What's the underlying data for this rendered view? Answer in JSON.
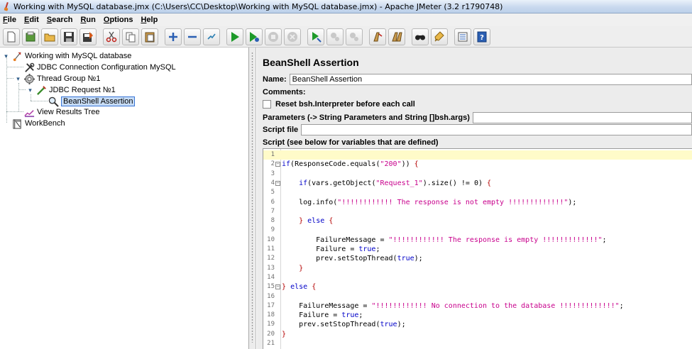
{
  "window": {
    "title": "Working with MySQL database.jmx (C:\\Users\\CC\\Desktop\\Working with MySQL database.jmx) - Apache JMeter (3.2 r1790748)"
  },
  "menu": [
    "File",
    "Edit",
    "Search",
    "Run",
    "Options",
    "Help"
  ],
  "toolbar": [
    "new-icon",
    "templates-icon",
    "open-icon",
    "save-icon",
    "save-as-icon",
    "cut-icon",
    "copy-icon",
    "paste-icon",
    "expand-icon",
    "collapse-icon",
    "toggle-icon",
    "start-icon",
    "start-no-pauses-icon",
    "stop-icon",
    "shutdown-icon",
    "remote-start-icon",
    "remote-stop-icon",
    "remote-shutdown-icon",
    "clear-icon",
    "clear-all-icon",
    "search-icon",
    "reset-search-icon",
    "function-helper-icon",
    "help-icon"
  ],
  "tree": {
    "nodes": [
      {
        "label": "Working with MySQL database",
        "icon": "test-plan-icon"
      },
      {
        "label": "JDBC Connection Configuration MySQL",
        "icon": "config-element-icon"
      },
      {
        "label": "Thread Group №1",
        "icon": "thread-group-icon"
      },
      {
        "label": "JDBC Request №1",
        "icon": "sampler-icon"
      },
      {
        "label": "BeanShell Assertion",
        "icon": "assertion-icon"
      },
      {
        "label": "View Results Tree",
        "icon": "listener-icon"
      },
      {
        "label": "WorkBench",
        "icon": "workbench-icon"
      }
    ]
  },
  "panel": {
    "title": "BeanShell Assertion",
    "name_label": "Name:",
    "name_value": "BeanShell Assertion",
    "comments_label": "Comments:",
    "reset_label": "Reset bsh.Interpreter before each call",
    "params_label": "Parameters (-> String Parameters and String []bsh.args)",
    "params_value": "",
    "script_file_label": "Script file",
    "script_file_value": "",
    "script_label": "Script (see below for variables that are defined)"
  },
  "script": {
    "lines": [
      "",
      "if(ResponseCode.equals(\"200\")) {",
      "",
      "    if(vars.getObject(\"Request_1\").size() != 0) {",
      "",
      "    log.info(\"!!!!!!!!!!!! The response is not empty !!!!!!!!!!!!!\");",
      "",
      "    } else {",
      "",
      "        FailureMessage = \"!!!!!!!!!!!! The response is empty !!!!!!!!!!!!!\";",
      "        Failure = true;",
      "        prev.setStopThread(true);",
      "    }",
      "",
      "} else {",
      "",
      "    FailureMessage = \"!!!!!!!!!!!! No connection to the database !!!!!!!!!!!!!\";",
      "    Failure = true;",
      "    prev.setStopThread(true);",
      "}",
      ""
    ],
    "fold_markers": [
      2,
      4,
      15
    ],
    "current_line": 1
  },
  "colors": {
    "keyword": "#0000c8",
    "string": "#c8008c",
    "brace": "#b40000",
    "selection": "#c7dcf5",
    "current_line": "#fffbc9"
  }
}
